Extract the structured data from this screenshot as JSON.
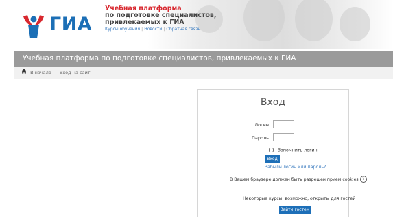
{
  "brand": {
    "logo_text": "ГИА",
    "tagline_line1": "Учебная платформа",
    "tagline_line2": "по подготовке специалистов,",
    "tagline_line3": "привлекаемых к ГИА",
    "links": [
      "Курсы обучения",
      "Новости",
      "Обратная связь"
    ],
    "colors": {
      "red": "#d8282f",
      "blue": "#1c6fb6",
      "title_bar": "#9a9a9a",
      "button": "#1d6fb8"
    }
  },
  "title_bar": {
    "text": "Учебная платформа по подготовке специалистов, привлекаемых к ГИА"
  },
  "breadcrumb": {
    "home_icon": "home-icon",
    "items": [
      "В начало",
      "Вход на сайт"
    ]
  },
  "login": {
    "title": "Вход",
    "username_label": "Логин",
    "username_value": "",
    "password_label": "Пароль",
    "password_value": "",
    "remember_label": "Запомнить логин",
    "remember_checked": false,
    "submit_label": "Вход",
    "forgot_link": "Забыли логин или пароль?",
    "cookies_note": "В Вашем браузере должен быть разрешен прием cookies",
    "help_icon": "help-icon",
    "guest_note": "Некоторые курсы, возможно, открыты для гостей",
    "guest_button": "Зайти гостем"
  }
}
